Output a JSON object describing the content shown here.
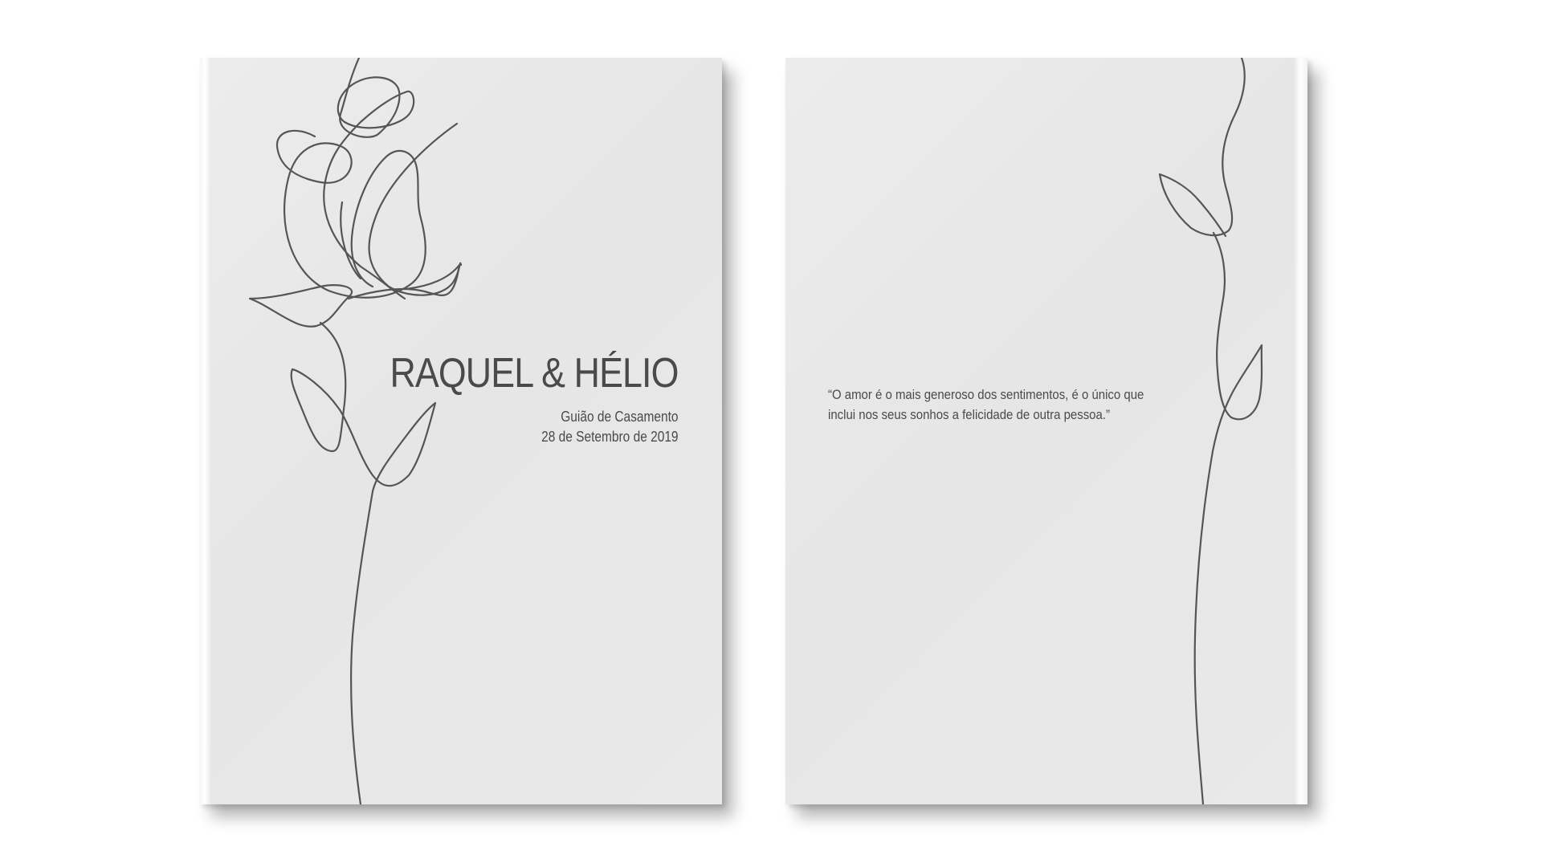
{
  "front_cover": {
    "title": "RAQUEL & HÉLIO",
    "subtitle": "Guião de Casamento",
    "date": "28 de Setembro de 2019",
    "illustration": "rose-line-art-icon"
  },
  "back_cover": {
    "quote_line_1": "“O amor é o mais generoso dos sentimentos, é o único que",
    "quote_line_2": "inclui nos seus sonhos a felicidade de outra pessoa.”",
    "illustration": "stem-line-art-icon"
  },
  "colors": {
    "cover": "#e9e9e9",
    "ink": "#4a4a4a"
  }
}
